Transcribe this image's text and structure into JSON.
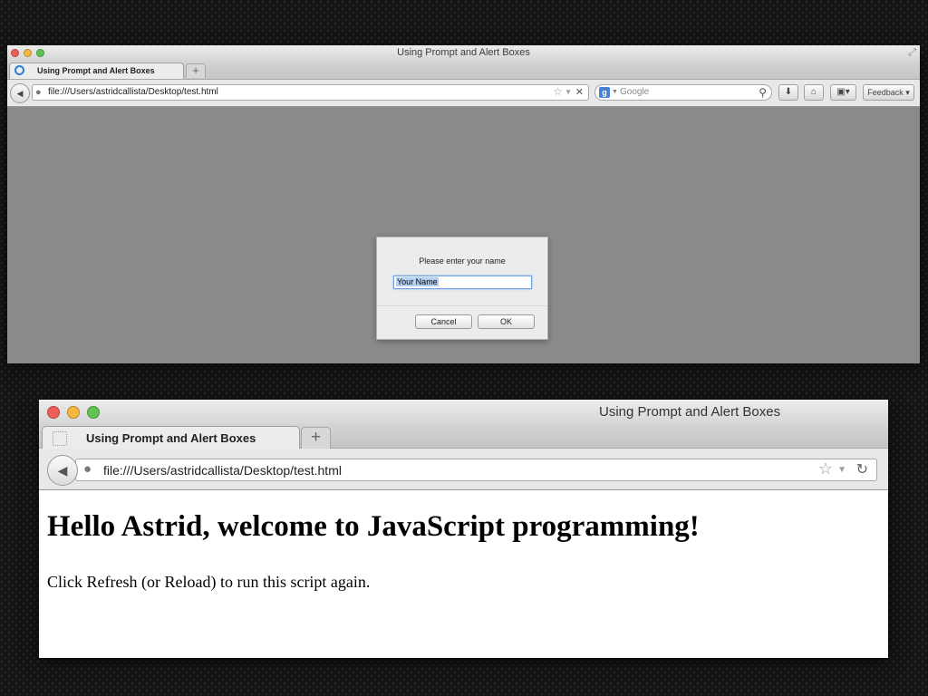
{
  "colors": {
    "close": "#ef5e57",
    "minimize": "#f5b73e",
    "zoom": "#60c451",
    "accent": "#2a7fd4"
  },
  "window_small": {
    "title": "Using Prompt and Alert Boxes",
    "tab_label": "Using Prompt and Alert Boxes",
    "new_tab": "+",
    "url": "file:///Users/astridcallista/Desktop/test.html",
    "search_placeholder": "Google",
    "feedback_label": "Feedback",
    "dialog": {
      "message": "Please enter your name",
      "input_value": "Your Name",
      "cancel_label": "Cancel",
      "ok_label": "OK"
    }
  },
  "window_large": {
    "title": "Using Prompt and Alert Boxes",
    "tab_label": "Using Prompt and Alert Boxes",
    "new_tab": "+",
    "url": "file:///Users/astridcallista/Desktop/test.html",
    "heading": "Hello Astrid, welcome to JavaScript programming!",
    "paragraph": "Click Refresh (or Reload) to run this script again."
  }
}
